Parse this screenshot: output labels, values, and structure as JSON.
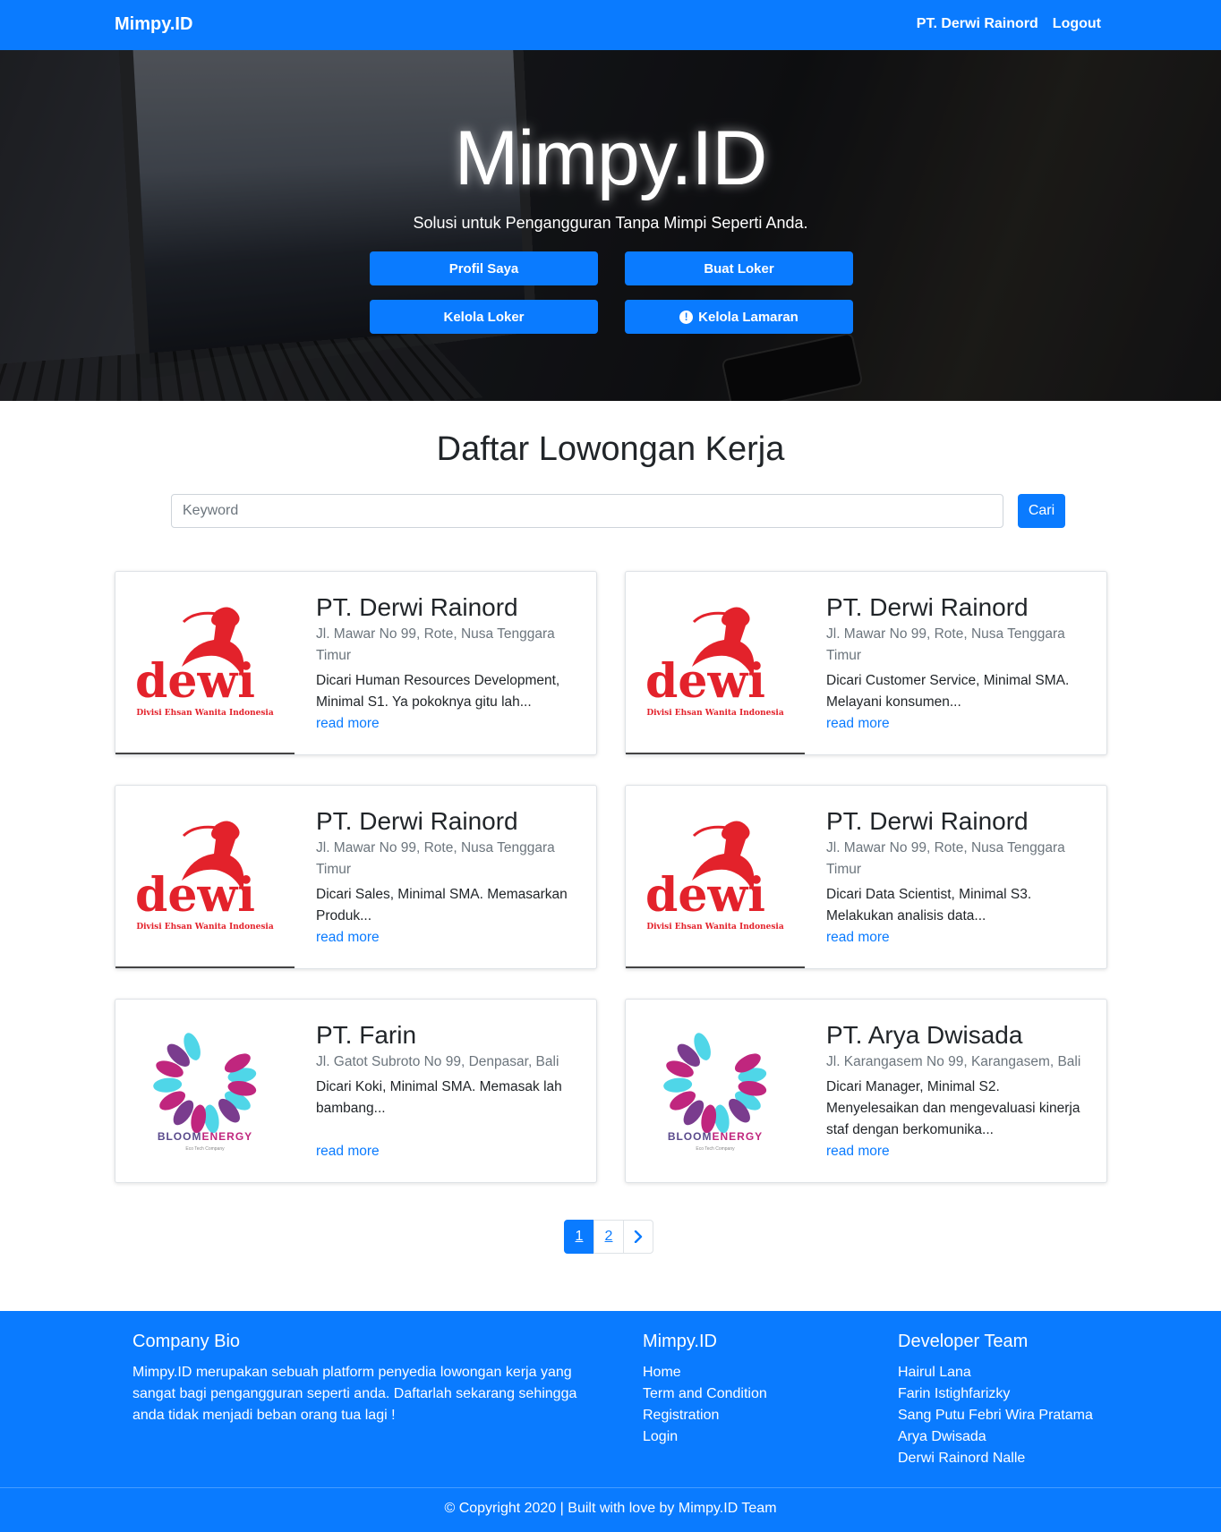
{
  "navbar": {
    "brand": "Mimpy.ID",
    "user": "PT. Derwi Rainord",
    "logout": "Logout"
  },
  "hero": {
    "title": "Mimpy.ID",
    "subtitle": "Solusi untuk Pengangguran Tanpa Mimpi Seperti Anda.",
    "buttons": {
      "profil": "Profil Saya",
      "buat": "Buat Loker",
      "kelola_loker": "Kelola Loker",
      "kelola_lamaran": "Kelola Lamaran"
    }
  },
  "section": {
    "title": "Daftar Lowongan Kerja",
    "search_placeholder": "Keyword",
    "search_button": "Cari"
  },
  "jobs": [
    {
      "company": "PT. Derwi Rainord",
      "address": "Jl. Mawar No 99, Rote, Nusa Tenggara Timur",
      "desc": "Dicari Human Resources Development, Minimal S1. Ya pokoknya gitu lah...",
      "link": "read more",
      "logo": "dewi-logo"
    },
    {
      "company": "PT. Derwi Rainord",
      "address": "Jl. Mawar No 99, Rote, Nusa Tenggara Timur",
      "desc": "Dicari Customer Service, Minimal SMA. Melayani konsumen...",
      "link": "read more",
      "logo": "dewi-logo"
    },
    {
      "company": "PT. Derwi Rainord",
      "address": "Jl. Mawar No 99, Rote, Nusa Tenggara Timur",
      "desc": "Dicari Sales, Minimal SMA. Memasarkan Produk...",
      "link": "read more",
      "logo": "dewi-logo"
    },
    {
      "company": "PT. Derwi Rainord",
      "address": "Jl. Mawar No 99, Rote, Nusa Tenggara Timur",
      "desc": "Dicari Data Scientist, Minimal S3. Melakukan analisis data...",
      "link": "read more",
      "logo": "dewi-logo"
    },
    {
      "company": "PT. Farin",
      "address": "Jl. Gatot Subroto No 99, Denpasar, Bali",
      "desc": "Dicari Koki, Minimal SMA. Memasak lah bambang...",
      "link": "read more",
      "logo": "bloomenergy-logo"
    },
    {
      "company": "PT. Arya Dwisada",
      "address": "Jl. Karangasem No 99, Karangasem, Bali",
      "desc": "Dicari Manager, Minimal S2. Menyelesaikan dan mengevaluasi kinerja staf dengan berkomunika...",
      "link": "read more",
      "logo": "bloomenergy-logo"
    }
  ],
  "logos": {
    "dewi_word": "dewi",
    "dewi_tagline": "Divisi Ehsan Wanita Indonesia",
    "bloom_part1": "BLOOM",
    "bloom_part2": "ENERGY",
    "bloom_tagline": "Eco Tech Company"
  },
  "pagination": {
    "pages": [
      "1",
      "2"
    ],
    "next": "›",
    "current": "1"
  },
  "footer": {
    "bio_title": "Company Bio",
    "bio_text": "Mimpy.ID merupakan sebuah platform penyedia lowongan kerja yang sangat bagi pengangguran seperti anda. Daftarlah sekarang sehingga anda tidak menjadi beban orang tua lagi !",
    "links_title": "Mimpy.ID",
    "links": [
      "Home",
      "Term and Condition",
      "Registration",
      "Login"
    ],
    "team_title": "Developer Team",
    "team": [
      "Hairul Lana",
      "Farin Istighfarizky",
      "Sang Putu Febri Wira Pratama",
      "Arya Dwisada",
      "Derwi Rainord Nalle"
    ],
    "copyright": "© Copyright 2020 | Built with love by Mimpy.ID Team"
  },
  "colors": {
    "primary": "#0a7bff",
    "dewi_red": "#e3222b",
    "bloom_pink": "#c0267e",
    "bloom_cyan": "#4fd6e8",
    "bloom_purple": "#7a3c8e"
  }
}
